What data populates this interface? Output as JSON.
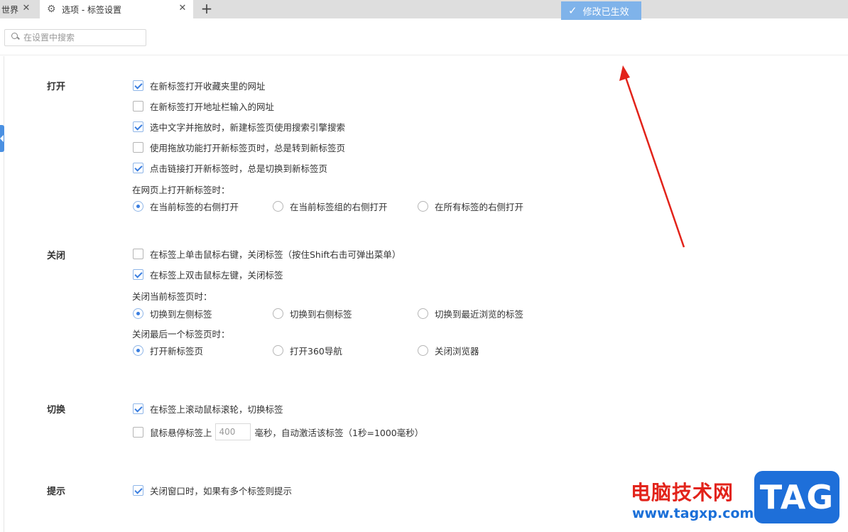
{
  "tabs": [
    {
      "label": "世界"
    },
    {
      "label": "选项 - 标签设置"
    }
  ],
  "search": {
    "placeholder": "在设置中搜索"
  },
  "toast": {
    "label": "修改已生效"
  },
  "sections": {
    "open": {
      "title": "打开",
      "options": [
        {
          "label": "在新标签打开收藏夹里的网址",
          "checked": true
        },
        {
          "label": "在新标签打开地址栏输入的网址",
          "checked": false
        },
        {
          "label": "选中文字并拖放时，新建标签页使用搜索引擎搜索",
          "checked": true
        },
        {
          "label": "使用拖放功能打开新标签页时，总是转到新标签页",
          "checked": false
        },
        {
          "label": "点击链接打开新标签时，总是切换到新标签页",
          "checked": true
        }
      ],
      "group_label": "在网页上打开新标签时：",
      "radios": [
        {
          "label": "在当前标签的右侧打开",
          "selected": true
        },
        {
          "label": "在当前标签组的右侧打开",
          "selected": false
        },
        {
          "label": "在所有标签的右侧打开",
          "selected": false
        }
      ]
    },
    "close": {
      "title": "关闭",
      "options": [
        {
          "label": "在标签上单击鼠标右键，关闭标签（按住Shift右击可弹出菜单）",
          "checked": false
        },
        {
          "label": "在标签上双击鼠标左键，关闭标签",
          "checked": true
        }
      ],
      "group1_label": "关闭当前标签页时：",
      "group1": [
        {
          "label": "切换到左侧标签",
          "selected": true
        },
        {
          "label": "切换到右侧标签",
          "selected": false
        },
        {
          "label": "切换到最近浏览的标签",
          "selected": false
        }
      ],
      "group2_label": "关闭最后一个标签页时：",
      "group2": [
        {
          "label": "打开新标签页",
          "selected": true
        },
        {
          "label": "打开360导航",
          "selected": false
        },
        {
          "label": "关闭浏览器",
          "selected": false
        }
      ]
    },
    "switch": {
      "title": "切换",
      "options": [
        {
          "label": "在标签上滚动鼠标滚轮，切换标签",
          "checked": true
        }
      ],
      "hover": {
        "prefix": "鼠标悬停标签上",
        "value": "400",
        "suffix": "毫秒，自动激活该标签（1秒=1000毫秒）",
        "checked": false
      }
    },
    "hint": {
      "title": "提示",
      "options": [
        {
          "label": "关闭窗口时，如果有多个标签则提示",
          "checked": true
        }
      ]
    }
  },
  "watermark": {
    "text": "电脑技术网",
    "url": "www.tagxp.com",
    "logo": "TAG"
  },
  "colors": {
    "accent": "#3a7ee0",
    "toast_bg": "#7fb3ea",
    "annotation_arrow": "#e2231a"
  }
}
